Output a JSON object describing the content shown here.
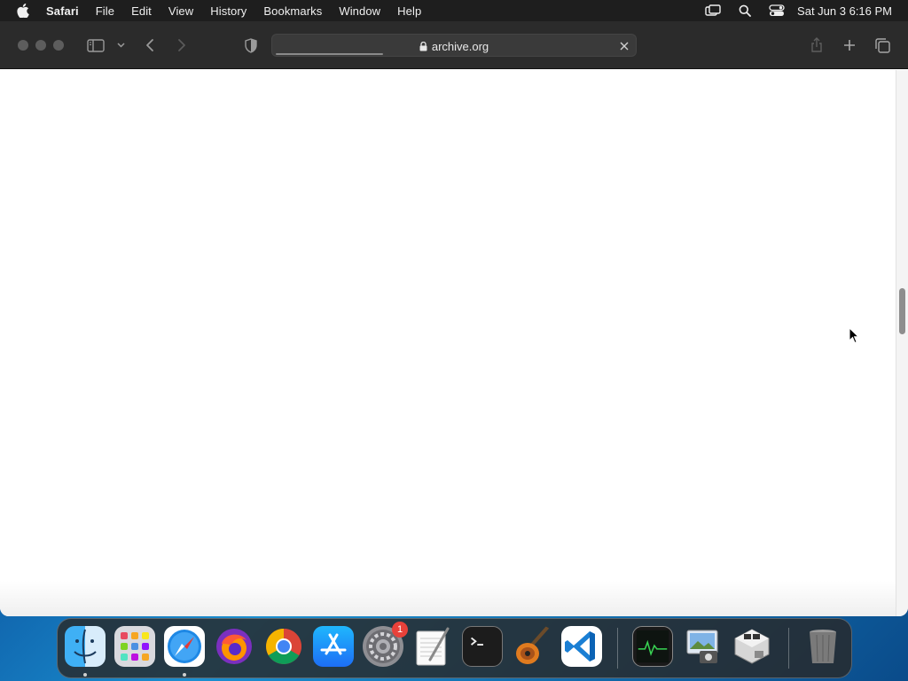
{
  "menubar": {
    "app_name": "Safari",
    "items": [
      "File",
      "Edit",
      "View",
      "History",
      "Bookmarks",
      "Window",
      "Help"
    ],
    "clock": "Sat Jun 3  6:16 PM",
    "status_icons": [
      "screen-mirroring-icon",
      "spotlight-search-icon",
      "control-center-icon"
    ]
  },
  "browser": {
    "address": "archive.org",
    "page_loading_progress": 0.3,
    "scroll_position": 0.45
  },
  "dock": {
    "apps": [
      {
        "name": "Finder",
        "icon": "finder-icon",
        "running": true
      },
      {
        "name": "Launchpad",
        "icon": "launchpad-icon",
        "running": false
      },
      {
        "name": "Safari",
        "icon": "safari-icon",
        "running": true
      },
      {
        "name": "Firefox",
        "icon": "firefox-icon",
        "running": false
      },
      {
        "name": "Chrome",
        "icon": "chrome-icon",
        "running": false
      },
      {
        "name": "App Store",
        "icon": "app-store-icon",
        "running": false
      },
      {
        "name": "System Preferences",
        "icon": "system-preferences-icon",
        "running": false,
        "badge": "1"
      },
      {
        "name": "TextEdit",
        "icon": "textedit-icon",
        "running": false
      },
      {
        "name": "Terminal",
        "icon": "terminal-icon",
        "running": false
      },
      {
        "name": "GarageBand",
        "icon": "garageband-icon",
        "running": false
      },
      {
        "name": "Visual Studio Code",
        "icon": "vscode-icon",
        "running": false
      },
      {
        "name": "Activity Monitor",
        "icon": "activity-monitor-icon",
        "running": false
      },
      {
        "name": "Preview",
        "icon": "preview-icon",
        "running": false
      },
      {
        "name": "Boot Camp Assistant",
        "icon": "bootcamp-icon",
        "running": false
      },
      {
        "name": "Trash",
        "icon": "trash-icon",
        "running": false
      }
    ]
  },
  "colors": {
    "menubar_bg": "#1e1e1e",
    "toolbar_bg": "#2b2b2b",
    "badge": "#e8413a"
  }
}
